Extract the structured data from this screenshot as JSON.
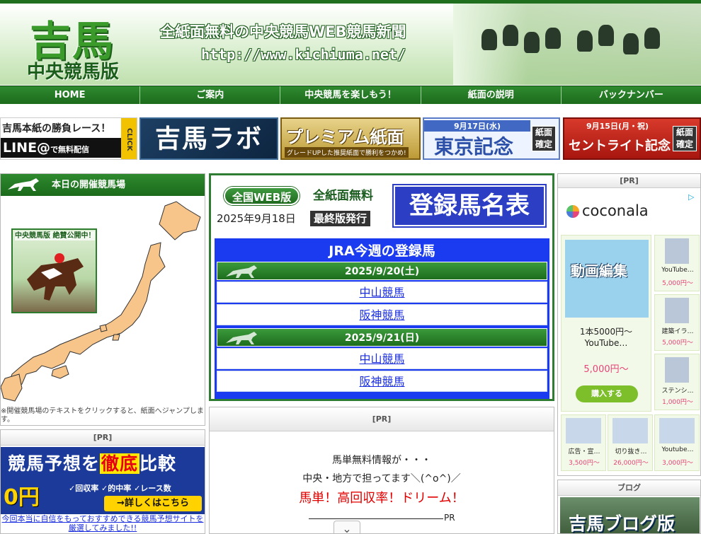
{
  "header": {
    "logo_main": "吉馬",
    "logo_sub": "中央競馬版",
    "tagline": "全紙面無料の中央競馬WEB競馬新聞",
    "url": "http://www.kichiuma.net/"
  },
  "nav": {
    "items": [
      "HOME",
      "ご案内",
      "中央競馬を楽しもう！",
      "紙面の説明",
      "バックナンバー"
    ]
  },
  "banners": {
    "line_top": "吉馬本紙の勝負レース！",
    "line_main": "LINE@",
    "line_sub": "で無料配信",
    "line_click": "CLICK",
    "labo": "吉馬ラボ",
    "premium_title": "プレミアム紙面",
    "premium_sub": "グレードUPした推奨紙面で勝利をつかめ!",
    "tokyo_date": "9月17日(水)",
    "tokyo_name": "東京記念",
    "tokyo_badge": "紙面確定",
    "st_date": "9月15日(月・祝)",
    "st_name": "セントライト記念",
    "st_badge": "紙面確定"
  },
  "left": {
    "title": "本日の開催競馬場",
    "ad_label": "中央競馬版 絶賛公開中！",
    "note": "※開催競馬場のテキストをクリックすると、紙面へジャンプします。"
  },
  "pr_left": {
    "title": "[PR]",
    "headline_pre": "競馬予想を",
    "headline_em": "徹底",
    "headline_post": "比較",
    "zero": "0円",
    "features": "✓回収率 ✓的中率 ✓レース数",
    "button": "→詳しくはこちら",
    "link": "今回本当に自信をもっておすすめできる競馬予想サイトを厳選してみました!!"
  },
  "center": {
    "web_badge": "全国WEB版",
    "free": "全紙面無料",
    "register": "登録馬名表",
    "date": "2025年9月18日",
    "final": "最終版発行",
    "jra_title": "JRA今週の登録馬",
    "days": [
      {
        "date": "2025/9/20(土)",
        "courses": [
          "中山競馬",
          "阪神競馬"
        ]
      },
      {
        "date": "2025/9/21(日)",
        "courses": [
          "中山競馬",
          "阪神競馬"
        ]
      }
    ]
  },
  "pr_center": {
    "title": "[PR]",
    "line1": "馬単無料情報が・・・",
    "line2": "中央・地方で担ってます＼(^o^)／",
    "line3": "馬単！高回収率！ドリーム！",
    "pr_tag": "PR",
    "chevron": "⌄"
  },
  "right": {
    "title": "[PR]",
    "brand": "coconala",
    "adchoice": "▷",
    "main_card": {
      "thumb_text": "動画編集",
      "title": "1本5000円〜 YouTube…",
      "price": "5,000円〜",
      "buy": "購入する"
    },
    "side_cards": [
      {
        "name": "YouTube…",
        "price": "5,000円〜"
      },
      {
        "name": "建築イラ…",
        "price": "5,000円〜"
      },
      {
        "name": "ステンシ…",
        "price": "1,000円〜"
      }
    ],
    "bottom_cards": [
      {
        "name": "広告・宣…",
        "price": "3,500円〜"
      },
      {
        "name": "切り抜き…",
        "price": "26,000円〜"
      },
      {
        "name": "Youtube…",
        "price": "3,000円〜"
      }
    ],
    "blog_title": "ブログ",
    "blog_banner": "吉馬ブログ版"
  },
  "colors": {
    "nav_green": "#1c6b1c",
    "jra_blue": "#1a3bf0",
    "link_blue": "#1a2ee0",
    "pr_red": "#e00000"
  }
}
